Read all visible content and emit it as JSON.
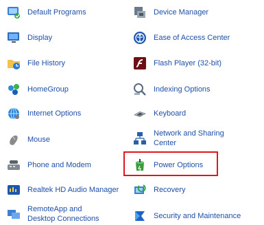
{
  "items": [
    {
      "label": "Default Programs",
      "icon": "default-programs-icon"
    },
    {
      "label": "Device Manager",
      "icon": "device-manager-icon"
    },
    {
      "label": "Display",
      "icon": "display-icon"
    },
    {
      "label": "Ease of Access Center",
      "icon": "ease-of-access-icon"
    },
    {
      "label": "File History",
      "icon": "file-history-icon"
    },
    {
      "label": "Flash Player (32-bit)",
      "icon": "flash-player-icon"
    },
    {
      "label": "HomeGroup",
      "icon": "homegroup-icon"
    },
    {
      "label": "Indexing Options",
      "icon": "indexing-options-icon"
    },
    {
      "label": "Internet Options",
      "icon": "internet-options-icon"
    },
    {
      "label": "Keyboard",
      "icon": "keyboard-icon"
    },
    {
      "label": "Mouse",
      "icon": "mouse-icon"
    },
    {
      "label": "Network and Sharing Center",
      "icon": "network-sharing-icon"
    },
    {
      "label": "Phone and Modem",
      "icon": "phone-modem-icon"
    },
    {
      "label": "Power Options",
      "icon": "power-options-icon",
      "highlighted": true
    },
    {
      "label": "Realtek HD Audio Manager",
      "icon": "realtek-audio-icon"
    },
    {
      "label": "Recovery",
      "icon": "recovery-icon"
    },
    {
      "label": "RemoteApp and Desktop Connections",
      "icon": "remoteapp-icon"
    },
    {
      "label": "Security and Maintenance",
      "icon": "security-maintenance-icon"
    }
  ],
  "colors": {
    "link": "#1e4fa8",
    "highlight_border": "#e0161b"
  }
}
